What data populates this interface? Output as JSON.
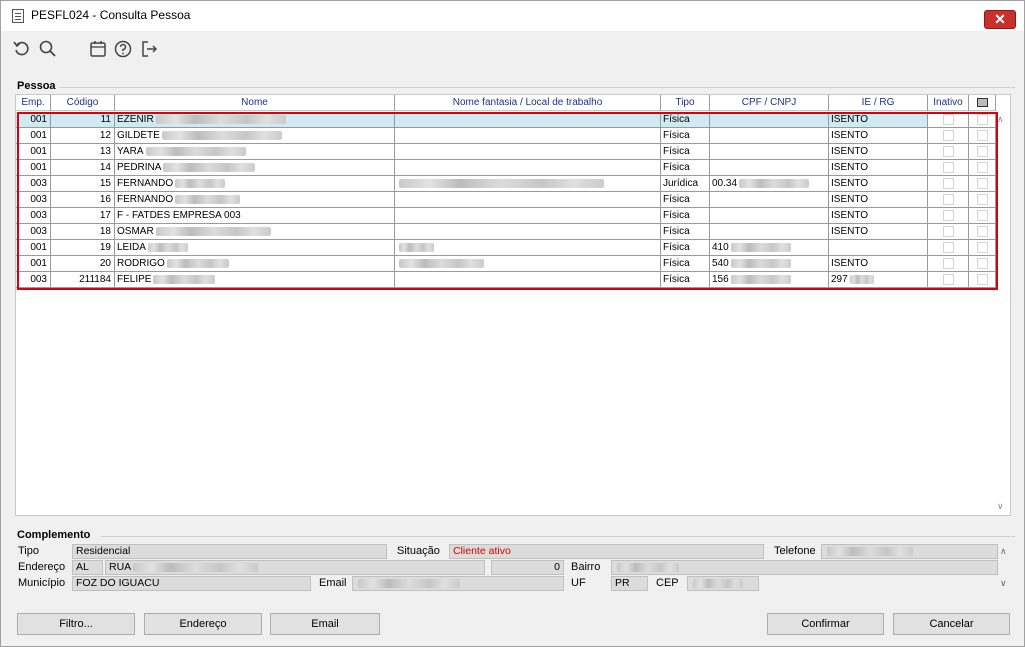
{
  "window": {
    "title": "PESFL024 - Consulta Pessoa",
    "close_label": "✕"
  },
  "toolbar": {
    "items": [
      {
        "name": "refresh-icon"
      },
      {
        "name": "search-icon"
      },
      {
        "name": "calendar-icon"
      },
      {
        "name": "help-icon"
      },
      {
        "name": "exit-icon"
      }
    ]
  },
  "pessoa": {
    "section_label": "Pessoa",
    "columns": [
      "Emp.",
      "Código",
      "Nome",
      "Nome fantasia / Local de trabalho",
      "Tipo",
      "CPF / CNPJ",
      "IE / RG",
      "Inativo",
      ""
    ],
    "rows": [
      {
        "emp": "001",
        "codigo": "11",
        "nome": "EZENIR",
        "fantasia": "",
        "tipo": "Física",
        "cpf": "",
        "ie": "ISENTO"
      },
      {
        "emp": "001",
        "codigo": "12",
        "nome": "GILDETE",
        "fantasia": "",
        "tipo": "Física",
        "cpf": "",
        "ie": "ISENTO"
      },
      {
        "emp": "001",
        "codigo": "13",
        "nome": "YARA",
        "fantasia": "",
        "tipo": "Física",
        "cpf": "",
        "ie": "ISENTO"
      },
      {
        "emp": "001",
        "codigo": "14",
        "nome": "PEDRINA",
        "fantasia": "",
        "tipo": "Física",
        "cpf": "",
        "ie": "ISENTO"
      },
      {
        "emp": "003",
        "codigo": "15",
        "nome": "FERNANDO",
        "fantasia": "",
        "tipo": "Jurídica",
        "cpf": "00.34",
        "ie": "ISENTO"
      },
      {
        "emp": "003",
        "codigo": "16",
        "nome": "FERNANDO",
        "fantasia": "",
        "tipo": "Física",
        "cpf": "",
        "ie": "ISENTO"
      },
      {
        "emp": "003",
        "codigo": "17",
        "nome": "F - FATDES EMPRESA 003",
        "fantasia": "",
        "tipo": "Física",
        "cpf": "",
        "ie": "ISENTO"
      },
      {
        "emp": "003",
        "codigo": "18",
        "nome": "OSMAR",
        "fantasia": "",
        "tipo": "Física",
        "cpf": "",
        "ie": "ISENTO"
      },
      {
        "emp": "001",
        "codigo": "19",
        "nome": "LEIDA",
        "fantasia": "",
        "tipo": "Física",
        "cpf": "410",
        "ie": ""
      },
      {
        "emp": "001",
        "codigo": "20",
        "nome": "RODRIGO",
        "fantasia": "",
        "tipo": "Física",
        "cpf": "540",
        "ie": "ISENTO"
      },
      {
        "emp": "003",
        "codigo": "211184",
        "nome": "FELIPE",
        "fantasia": "",
        "tipo": "Física",
        "cpf": "156",
        "ie": "297"
      }
    ]
  },
  "complemento": {
    "section_label": "Complemento",
    "tipo_label": "Tipo",
    "tipo_value": "Residencial",
    "situacao_label": "Situação",
    "situacao_value": "Cliente ativo",
    "telefone_label": "Telefone",
    "endereco_label": "Endereço",
    "endereco_tipo": "AL",
    "endereco_rua": "RUA",
    "endereco_numero": "0",
    "bairro_label": "Bairro",
    "municipio_label": "Município",
    "municipio_value": "FOZ DO IGUACU",
    "email_label": "Email",
    "uf_label": "UF",
    "uf_value": "PR",
    "cep_label": "CEP"
  },
  "buttons": {
    "filtro": "Filtro...",
    "endereco": "Endereço",
    "email": "Email",
    "confirmar": "Confirmar",
    "cancelar": "Cancelar"
  },
  "colors": {
    "selection_border": "#d9000d",
    "selected_row": "#cfeaf3",
    "header_text": "#1f2f8f",
    "status_text": "#d40000"
  }
}
